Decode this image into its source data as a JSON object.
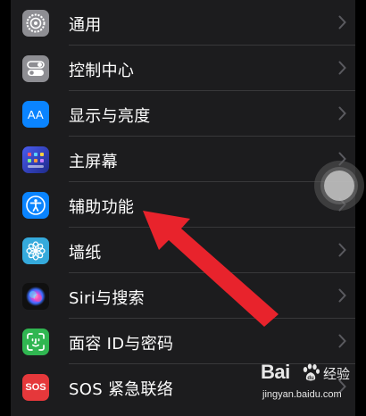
{
  "settings": {
    "items": [
      {
        "label": "通用",
        "icon": "gear-icon",
        "color": "#8e8e93"
      },
      {
        "label": "控制中心",
        "icon": "toggles-icon",
        "color": "#8e8e93"
      },
      {
        "label": "显示与亮度",
        "icon": "aa-icon",
        "icon_text": "AA",
        "color": "#0a84ff"
      },
      {
        "label": "主屏幕",
        "icon": "home-grid-icon",
        "color": "#2c3fbf"
      },
      {
        "label": "辅助功能",
        "icon": "accessibility-icon",
        "color": "#0a84ff"
      },
      {
        "label": "墙纸",
        "icon": "flower-icon",
        "color": "#35aadc"
      },
      {
        "label": "Siri与搜索",
        "icon": "siri-icon",
        "color": "#1a1a1a"
      },
      {
        "label": "面容 ID与密码",
        "icon": "face-id-icon",
        "color": "#30b651"
      },
      {
        "label": "SOS 紧急联络",
        "icon": "sos-icon",
        "icon_text": "SOS",
        "color": "#e5383b"
      }
    ]
  },
  "assistive_touch": {
    "icon": "assistive-touch-icon"
  },
  "annotation": {
    "icon": "red-arrow-icon",
    "color": "#e8232c"
  },
  "watermark": {
    "brand": "Bai",
    "brand_suffix": "经验",
    "url": "jingyan.baidu.com"
  }
}
